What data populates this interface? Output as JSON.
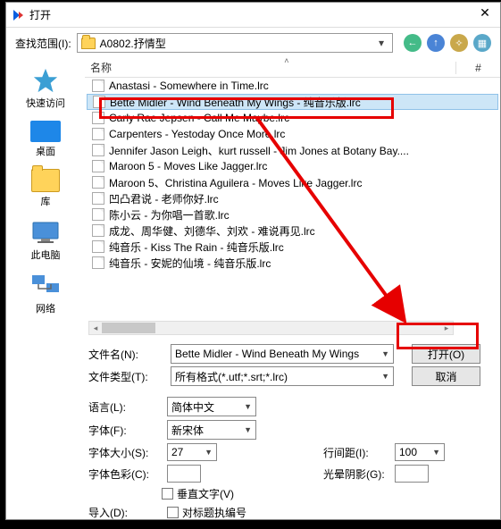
{
  "title": "打开",
  "lookin_label": "查找范围(I):",
  "path": "A0802.抒情型",
  "places": {
    "quick": "快速访问",
    "desktop": "桌面",
    "lib": "库",
    "pc": "此电脑",
    "net": "网络"
  },
  "columns": {
    "name": "名称",
    "hash": "#"
  },
  "files": [
    "Anastasi - Somewhere in Time.lrc",
    "Bette Midler - Wind Beneath My Wings - 纯音乐版.lrc",
    "Carly Rae Jepsen - Call Me Maybe.lrc",
    "Carpenters - Yestoday Once More.lrc",
    "Jennifer Jason Leigh、kurt russell - Jim Jones at Botany Bay....",
    "Maroon 5 - Moves Like Jagger.lrc",
    "Maroon 5、Christina Aguilera - Moves Like Jagger.lrc",
    "凹凸君说 - 老师你好.lrc",
    "陈小云 - 为你唱一首歌.lrc",
    "成龙、周华健、刘德华、刘欢 - 难说再见.lrc",
    "纯音乐 - Kiss The Rain - 纯音乐版.lrc",
    "纯音乐 - 安妮的仙境 - 纯音乐版.lrc"
  ],
  "selected_index": 1,
  "filename_label": "文件名(N):",
  "filename_value": "Bette Midler - Wind Beneath My Wings",
  "filetype_label": "文件类型(T):",
  "filetype_value": "所有格式(*.utf;*.srt;*.lrc)",
  "open_btn": "打开(O)",
  "cancel_btn": "取消",
  "lang_label": "语言(L):",
  "lang_value": "简体中文",
  "font_label": "字体(F):",
  "font_value": "新宋体",
  "size_label": "字体大小(S):",
  "size_value": "27",
  "linespace_label": "行间距(I):",
  "linespace_value": "100",
  "color_label": "字体色彩(C):",
  "glow_label": "光晕阴影(G):",
  "vertical_label": "垂直文字(V)",
  "import_label": "导入(D):",
  "import_chk": "对标题执编号"
}
